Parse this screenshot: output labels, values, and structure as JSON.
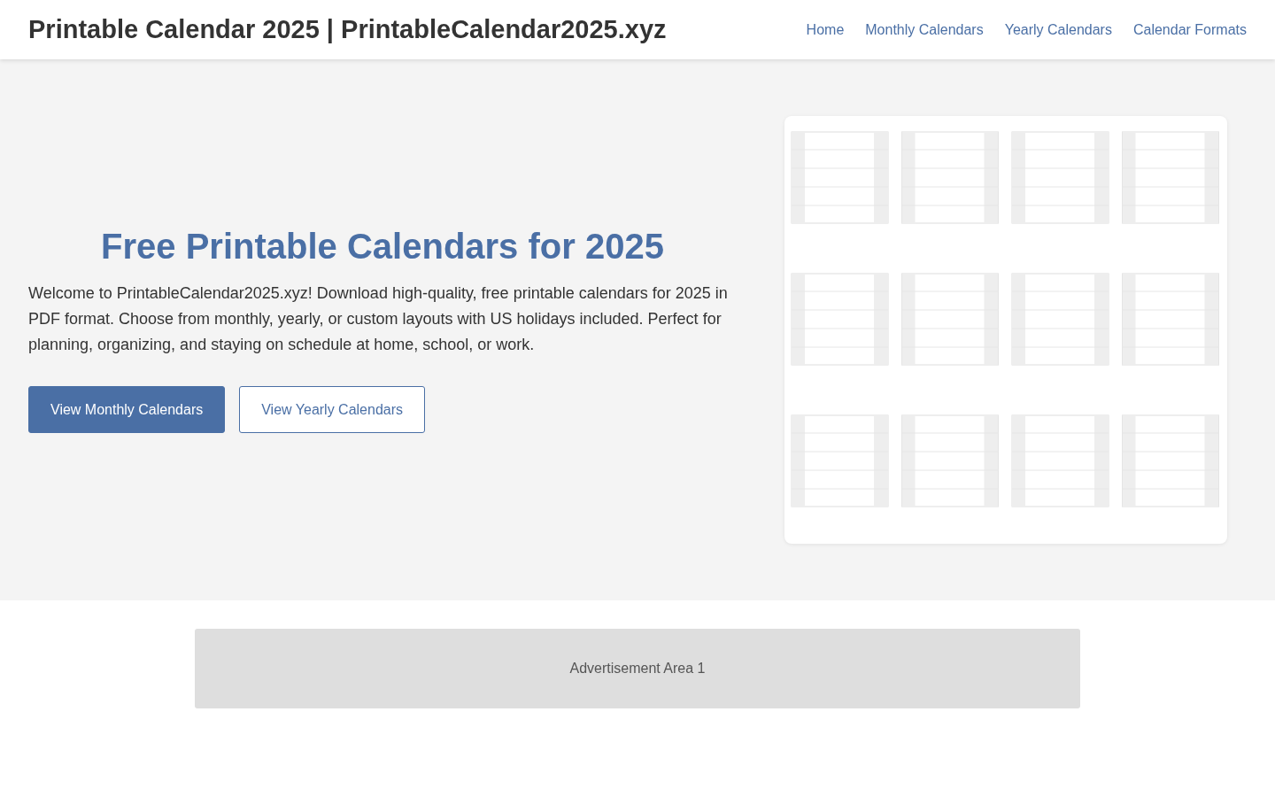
{
  "header": {
    "title": "Printable Calendar 2025 | PrintableCalendar2025.xyz",
    "nav": [
      "Home",
      "Monthly Calendars",
      "Yearly Calendars",
      "Calendar Formats"
    ]
  },
  "hero": {
    "heading": "Free Printable Calendars for 2025",
    "text": "Welcome to PrintableCalendar2025.xyz! Download high-quality, free printable calendars for 2025 in PDF format. Choose from monthly, yearly, or custom layouts with US holidays included. Perfect for planning, organizing, and staying on schedule at home, school, or work.",
    "buttons": [
      {
        "label": "View Monthly Calendars",
        "kind": "primary"
      },
      {
        "label": "View Yearly Calendars",
        "kind": "outline"
      }
    ]
  },
  "ad": {
    "label": "Advertisement Area 1"
  }
}
